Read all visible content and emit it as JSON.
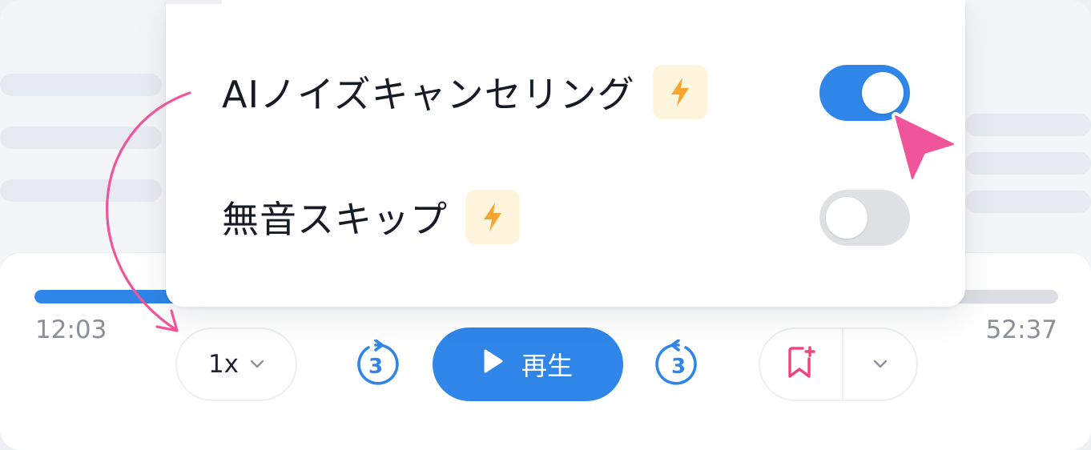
{
  "player": {
    "progress_fraction": 0.15,
    "elapsed_time": "12:03",
    "total_time": "52:37",
    "speed_label": "1x",
    "play_label": "再生",
    "skip_back_seconds": "3",
    "skip_forward_seconds": "3"
  },
  "settings_popup": {
    "items": [
      {
        "label": "AIノイズキャンセリング",
        "badge_icon": "lightning-icon",
        "enabled": true
      },
      {
        "label": "無音スキップ",
        "badge_icon": "lightning-icon",
        "enabled": false
      }
    ]
  },
  "colors": {
    "accent": "#2f86e8",
    "badge_bg": "#fff5dd",
    "badge_icon": "#f6a531",
    "bookmark_icon": "#f0447a",
    "annotation_pink": "#f0559b"
  },
  "icons": {
    "speed_dropdown": "chevron-down-icon",
    "play": "play-icon",
    "skip_back": "rewind-icon",
    "skip_forward": "forward-icon",
    "bookmark": "bookmark-add-icon",
    "bookmark_menu": "chevron-down-icon",
    "cursor": "cursor-pointer-icon"
  }
}
